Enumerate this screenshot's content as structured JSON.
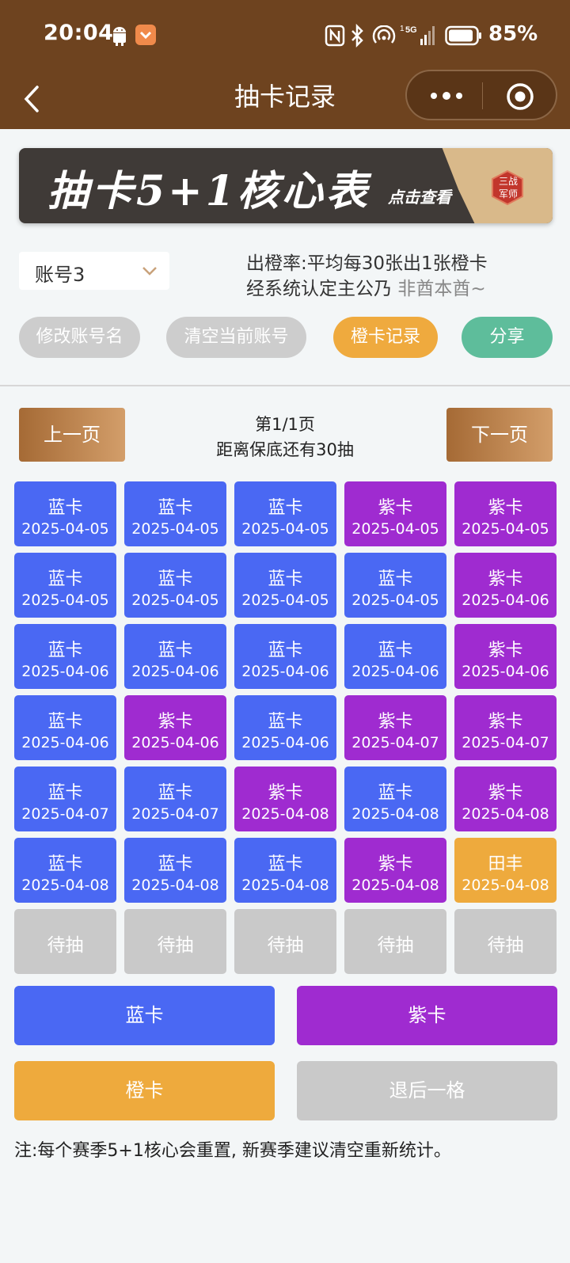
{
  "status_bar": {
    "time": "20:04",
    "battery_percent": "85%",
    "network": "5G"
  },
  "nav": {
    "title": "抽卡记录"
  },
  "banner": {
    "title": "抽卡5+1核心表",
    "subtitle": "点击查看",
    "seal_line1": "三战",
    "seal_line2": "军师"
  },
  "account": {
    "selected": "账号3"
  },
  "rate": {
    "line1": "出橙率:平均每30张出1张橙卡",
    "line2_prefix": "经系统认定主公乃",
    "line2_hint": "非酋本酋~"
  },
  "actions": {
    "rename": "修改账号名",
    "clear": "清空当前账号",
    "orange_record": "橙卡记录",
    "share": "分享"
  },
  "pager": {
    "prev": "上一页",
    "next": "下一页",
    "page_text": "第1/1页",
    "pity_text": "距离保底还有30抽"
  },
  "cards": [
    {
      "type": "蓝卡",
      "date": "2025-04-05",
      "color": "blue"
    },
    {
      "type": "蓝卡",
      "date": "2025-04-05",
      "color": "blue"
    },
    {
      "type": "蓝卡",
      "date": "2025-04-05",
      "color": "blue"
    },
    {
      "type": "紫卡",
      "date": "2025-04-05",
      "color": "purple"
    },
    {
      "type": "紫卡",
      "date": "2025-04-05",
      "color": "purple"
    },
    {
      "type": "蓝卡",
      "date": "2025-04-05",
      "color": "blue"
    },
    {
      "type": "蓝卡",
      "date": "2025-04-05",
      "color": "blue"
    },
    {
      "type": "蓝卡",
      "date": "2025-04-05",
      "color": "blue"
    },
    {
      "type": "蓝卡",
      "date": "2025-04-05",
      "color": "blue"
    },
    {
      "type": "紫卡",
      "date": "2025-04-06",
      "color": "purple"
    },
    {
      "type": "蓝卡",
      "date": "2025-04-06",
      "color": "blue"
    },
    {
      "type": "蓝卡",
      "date": "2025-04-06",
      "color": "blue"
    },
    {
      "type": "蓝卡",
      "date": "2025-04-06",
      "color": "blue"
    },
    {
      "type": "蓝卡",
      "date": "2025-04-06",
      "color": "blue"
    },
    {
      "type": "紫卡",
      "date": "2025-04-06",
      "color": "purple"
    },
    {
      "type": "蓝卡",
      "date": "2025-04-06",
      "color": "blue"
    },
    {
      "type": "紫卡",
      "date": "2025-04-06",
      "color": "purple"
    },
    {
      "type": "蓝卡",
      "date": "2025-04-06",
      "color": "blue"
    },
    {
      "type": "紫卡",
      "date": "2025-04-07",
      "color": "purple"
    },
    {
      "type": "紫卡",
      "date": "2025-04-07",
      "color": "purple"
    },
    {
      "type": "蓝卡",
      "date": "2025-04-07",
      "color": "blue"
    },
    {
      "type": "蓝卡",
      "date": "2025-04-07",
      "color": "blue"
    },
    {
      "type": "紫卡",
      "date": "2025-04-08",
      "color": "purple"
    },
    {
      "type": "蓝卡",
      "date": "2025-04-08",
      "color": "blue"
    },
    {
      "type": "紫卡",
      "date": "2025-04-08",
      "color": "purple"
    },
    {
      "type": "蓝卡",
      "date": "2025-04-08",
      "color": "blue"
    },
    {
      "type": "蓝卡",
      "date": "2025-04-08",
      "color": "blue"
    },
    {
      "type": "蓝卡",
      "date": "2025-04-08",
      "color": "blue"
    },
    {
      "type": "紫卡",
      "date": "2025-04-08",
      "color": "purple"
    },
    {
      "type": "田丰",
      "date": "2025-04-08",
      "color": "orange"
    },
    {
      "type": "待抽",
      "date": "",
      "color": "grey"
    },
    {
      "type": "待抽",
      "date": "",
      "color": "grey"
    },
    {
      "type": "待抽",
      "date": "",
      "color": "grey"
    },
    {
      "type": "待抽",
      "date": "",
      "color": "grey"
    },
    {
      "type": "待抽",
      "date": "",
      "color": "grey"
    }
  ],
  "draw_buttons": {
    "blue": "蓝卡",
    "purple": "紫卡",
    "orange": "橙卡",
    "undo": "退后一格"
  },
  "note": "注:每个赛季5+1核心会重置, 新赛季建议清空重新统计。",
  "colors": {
    "header_brown": "#6e431f",
    "blue_card": "#4a68f3",
    "purple_card": "#9f2bd0",
    "orange_card": "#eeaa3d",
    "grey_card": "#c9c9c9",
    "teal_button": "#5ebd9b"
  }
}
